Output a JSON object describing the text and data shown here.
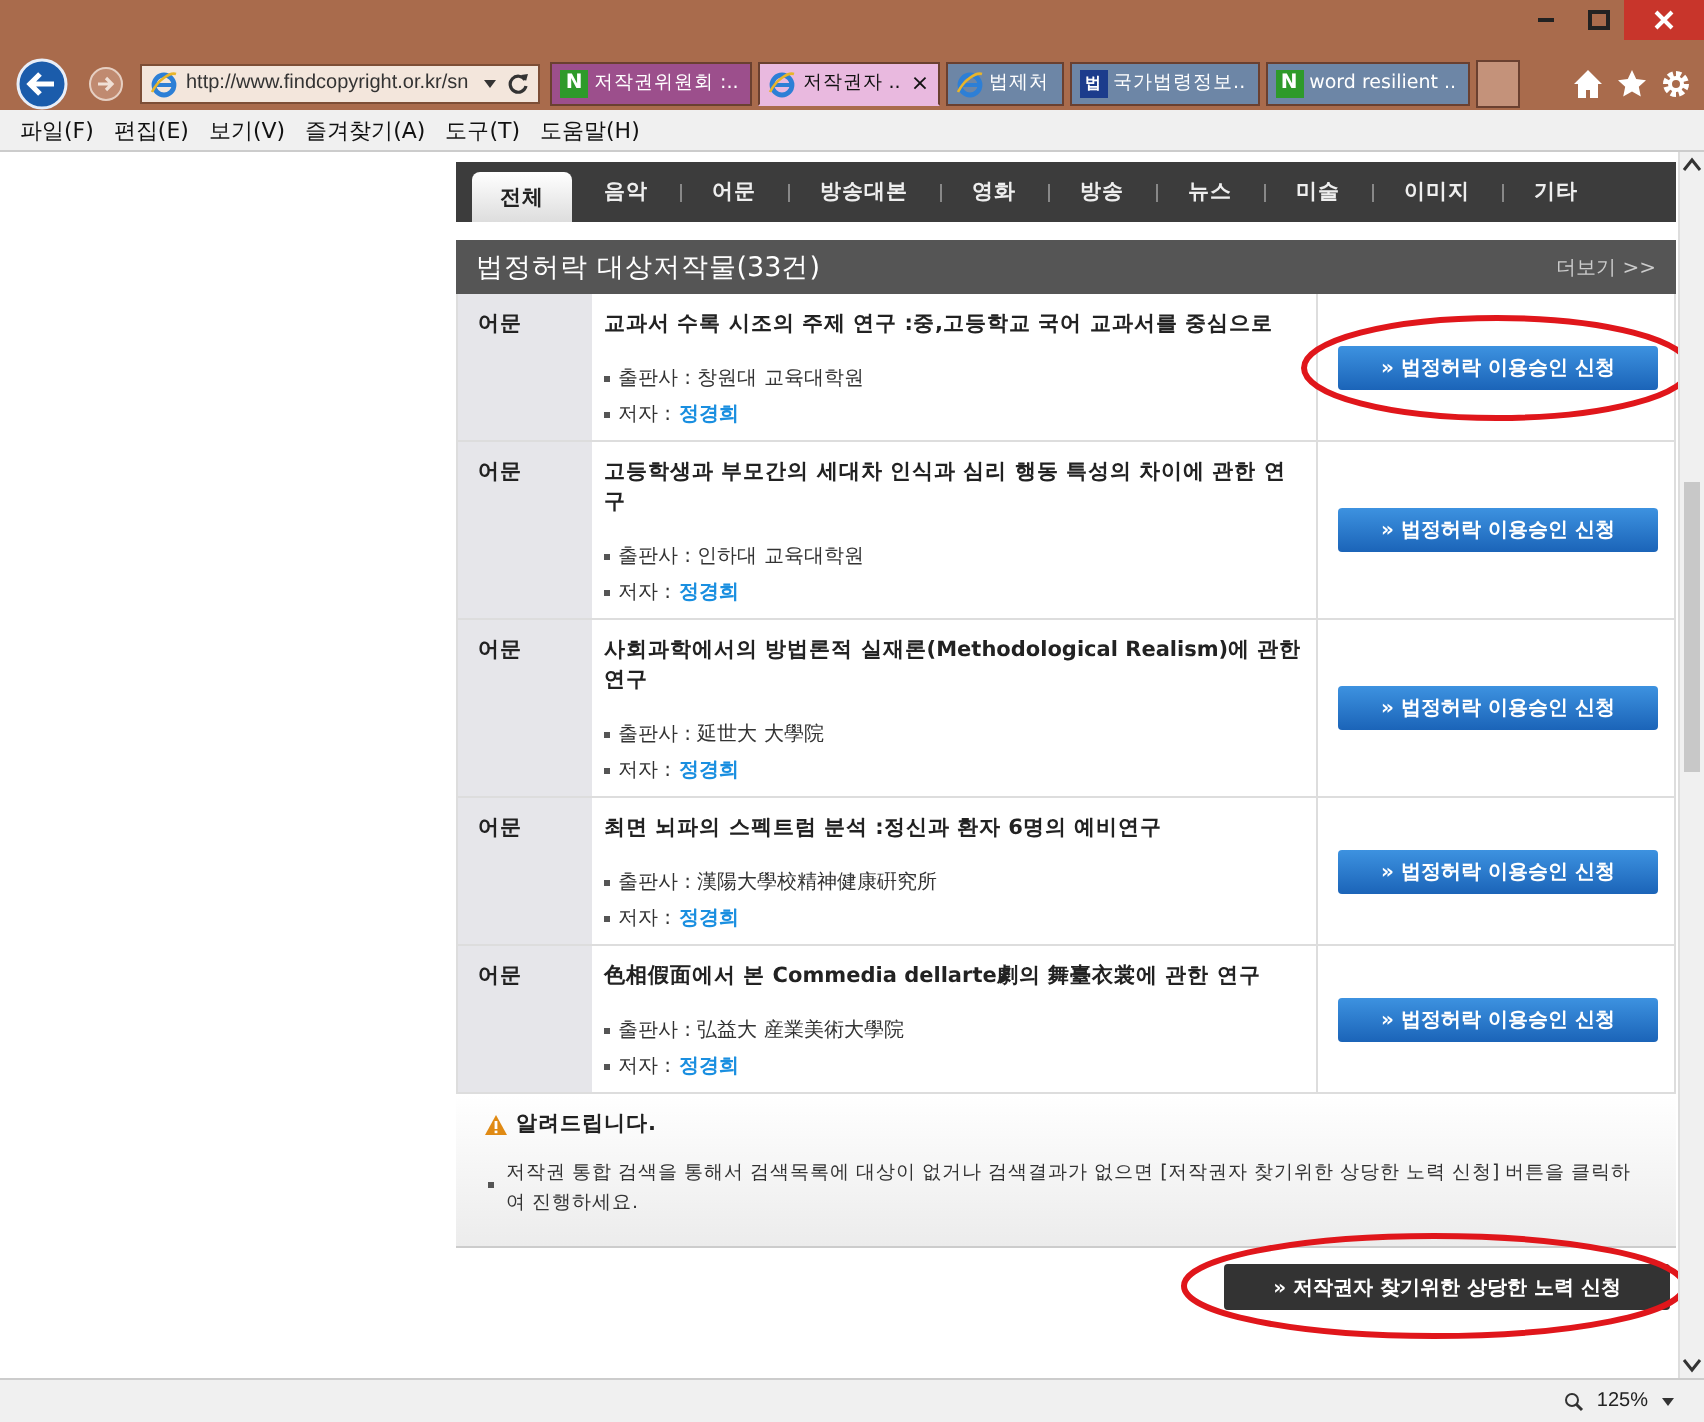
{
  "browser": {
    "address": "http://www.findcopyright.or.kr/sn",
    "tabs": [
      {
        "label": "저작권위원회 :..",
        "kind": "badge",
        "badge": "N",
        "color": "#9c4f8c",
        "selected": false
      },
      {
        "label": "저작권자 ..",
        "kind": "ie",
        "color": "#e9b9df",
        "selected": true,
        "close": "×"
      },
      {
        "label": "법제처",
        "kind": "ie",
        "color": "#6d86a6",
        "selected": false
      },
      {
        "label": "국가법령정보..",
        "kind": "badge",
        "badge": "법",
        "color": "#6d86a6",
        "selected": false
      },
      {
        "label": "word resilient ..",
        "kind": "badge",
        "badge": "N",
        "color": "#6d86a6",
        "selected": false
      }
    ],
    "menu": [
      "파일(F)",
      "편집(E)",
      "보기(V)",
      "즐겨찾기(A)",
      "도구(T)",
      "도움말(H)"
    ],
    "zoom": "125%"
  },
  "categories": [
    {
      "label": "전체",
      "selected": true
    },
    {
      "label": "음악",
      "selected": false
    },
    {
      "label": "어문",
      "selected": false
    },
    {
      "label": "방송대본",
      "selected": false
    },
    {
      "label": "영화",
      "selected": false
    },
    {
      "label": "방송",
      "selected": false
    },
    {
      "label": "뉴스",
      "selected": false
    },
    {
      "label": "미술",
      "selected": false
    },
    {
      "label": "이미지",
      "selected": false
    },
    {
      "label": "기타",
      "selected": false
    }
  ],
  "section": {
    "title": "법정허락 대상저작물(33건)",
    "more": "더보기 >>"
  },
  "results": [
    {
      "type": "어문",
      "title": "교과서 수록 시조의 주제 연구 :중,고등학교 국어 교과서를 중심으로",
      "publisher": "출판사 : 창원대 교육대학원",
      "author_label": "저자 :",
      "author": "정경희",
      "button": "» 법정허락 이용승인 신청",
      "circled": true
    },
    {
      "type": "어문",
      "title": "고등학생과 부모간의 세대차 인식과 심리 행동 특성의 차이에 관한 연구",
      "publisher": "출판사 : 인하대 교육대학원",
      "author_label": "저자 :",
      "author": "정경희",
      "button": "» 법정허락 이용승인 신청",
      "circled": false
    },
    {
      "type": "어문",
      "title": "사회과학에서의 방법론적 실재론(Methodological Realism)에 관한 연구",
      "publisher": "출판사 : 延世大 大學院",
      "author_label": "저자 :",
      "author": "정경희",
      "button": "» 법정허락 이용승인 신청",
      "circled": false
    },
    {
      "type": "어문",
      "title": "최면 뇌파의 스펙트럼 분석 :정신과 환자 6명의 예비연구",
      "publisher": "출판사 : 漢陽大學校精神健康硏究所",
      "author_label": "저자 :",
      "author": "정경희",
      "button": "» 법정허락 이용승인 신청",
      "circled": false
    },
    {
      "type": "어문",
      "title": "色相假面에서 본 Commedia dellarte劇의 舞臺衣裳에 관한 연구",
      "publisher": "출판사 : 弘益大 産業美術大學院",
      "author_label": "저자 :",
      "author": "정경희",
      "button": "» 법정허락 이용승인 신청",
      "circled": false
    }
  ],
  "notice": {
    "title": "알려드립니다.",
    "text": "저작권 통합 검색을 통해서 검색목록에 대상이 없거나 검색결과가 없으면 [저작권자 찾기위한 상당한 노력 신청] 버튼을 클릭하여 진행하세요."
  },
  "effort_button": {
    "label": "» 저작권자 찾기위한 상당한 노력 신청",
    "circled": true
  }
}
